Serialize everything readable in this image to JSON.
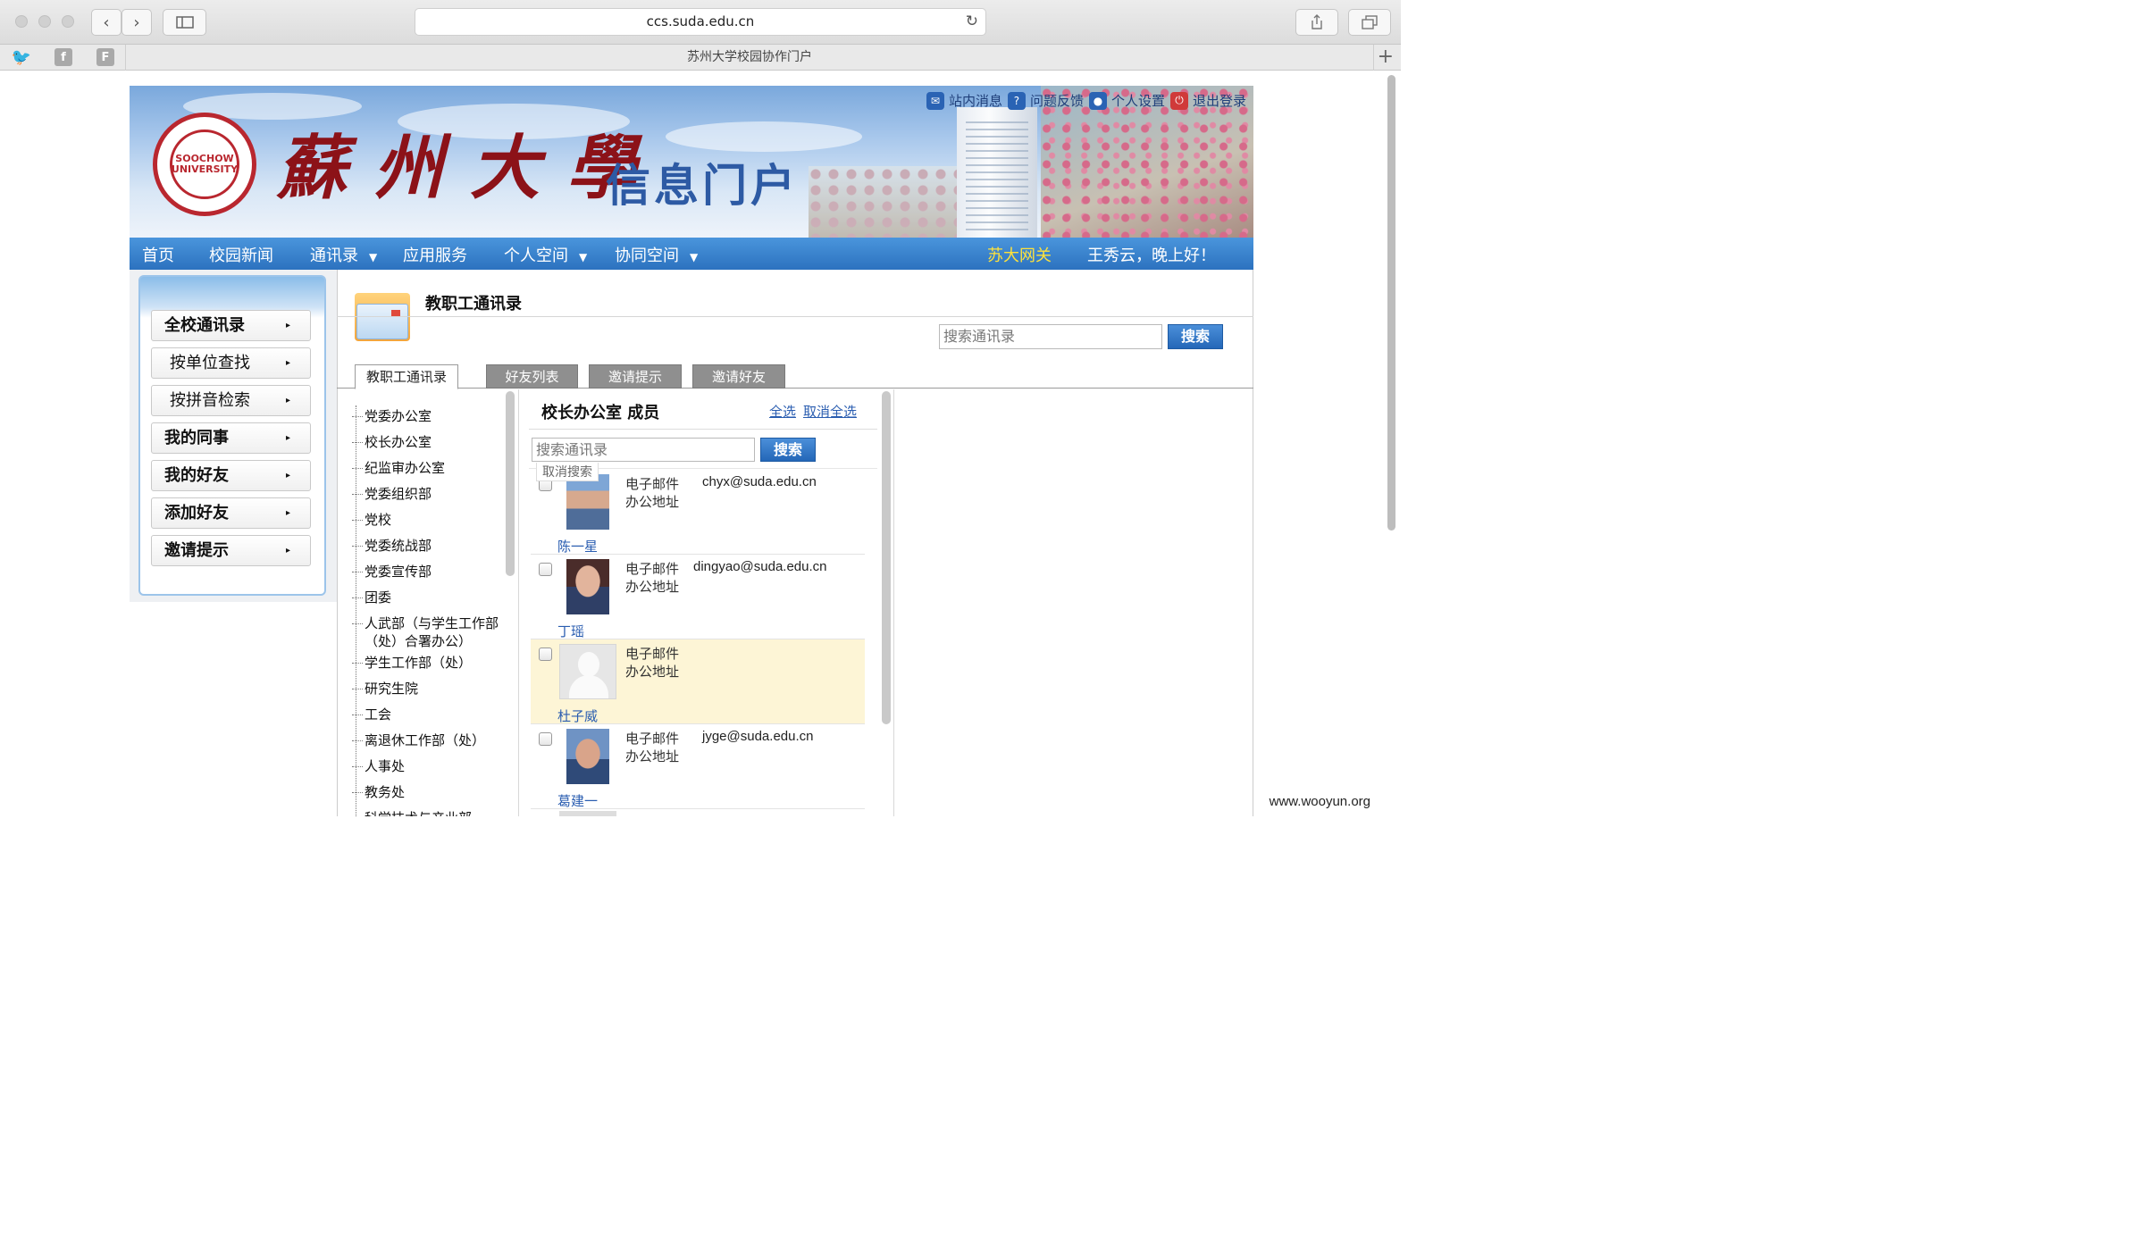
{
  "browser": {
    "url": "ccs.suda.edu.cn",
    "tab_title": "苏州大学校园协作门户",
    "back": "‹",
    "forward": "›",
    "reload": "↻",
    "new_tab": "+",
    "bookmarks": [
      "twitter",
      "facebook",
      "F"
    ]
  },
  "banner": {
    "seal_text": "SOOCHOW UNIVERSITY",
    "university_name": "蘇州大學",
    "portal_name": "信息门户",
    "top_links": [
      {
        "label": "站内消息",
        "icon": "message-icon"
      },
      {
        "label": "问题反馈",
        "icon": "feedback-icon"
      },
      {
        "label": "个人设置",
        "icon": "user-settings-icon"
      },
      {
        "label": "退出登录",
        "icon": "power-icon"
      }
    ]
  },
  "nav": {
    "items": [
      "首页",
      "校园新闻",
      "通讯录",
      "应用服务",
      "个人空间",
      "协同空间"
    ],
    "dropdown_arrow": "▼",
    "gateway": "苏大网关",
    "greeting": "王秀云，晚上好！"
  },
  "sidebar": {
    "items": [
      "全校通讯录",
      "按单位查找",
      "按拼音检索",
      "我的同事",
      "我的好友",
      "添加好友",
      "邀请提示"
    ],
    "arrow": "▸"
  },
  "page": {
    "title": "教职工通讯录",
    "search_placeholder": "搜索通讯录",
    "search_button": "搜索",
    "tabs": [
      "教职工通讯录",
      "好友列表",
      "邀请提示",
      "邀请好友"
    ]
  },
  "departments": [
    "党委办公室",
    "校长办公室",
    "纪监审办公室",
    "党委组织部",
    "党校",
    "党委统战部",
    "党委宣传部",
    "团委",
    "人武部（与学生工作部（处）合署办公）",
    "学生工作部（处）",
    "研究生院",
    "工会",
    "离退休工作部（处）",
    "人事处",
    "教务处",
    "科学技术与产业部"
  ],
  "members_panel": {
    "title": "校长办公室 成员",
    "select_all": "全选",
    "unselect_all": "取消全选",
    "search_placeholder": "搜索通讯录",
    "search_button": "搜索",
    "cancel_search": "取消搜索",
    "email_label": "电子邮件",
    "address_label": "办公地址",
    "members": [
      {
        "name": "陈一星",
        "email": "chyx@suda.edu.cn"
      },
      {
        "name": "丁瑶",
        "email": "dingyao@suda.edu.cn"
      },
      {
        "name": "杜子威",
        "email": ""
      },
      {
        "name": "葛建一",
        "email": "jyge@suda.edu.cn"
      }
    ]
  },
  "watermark": "www.wooyun.org"
}
